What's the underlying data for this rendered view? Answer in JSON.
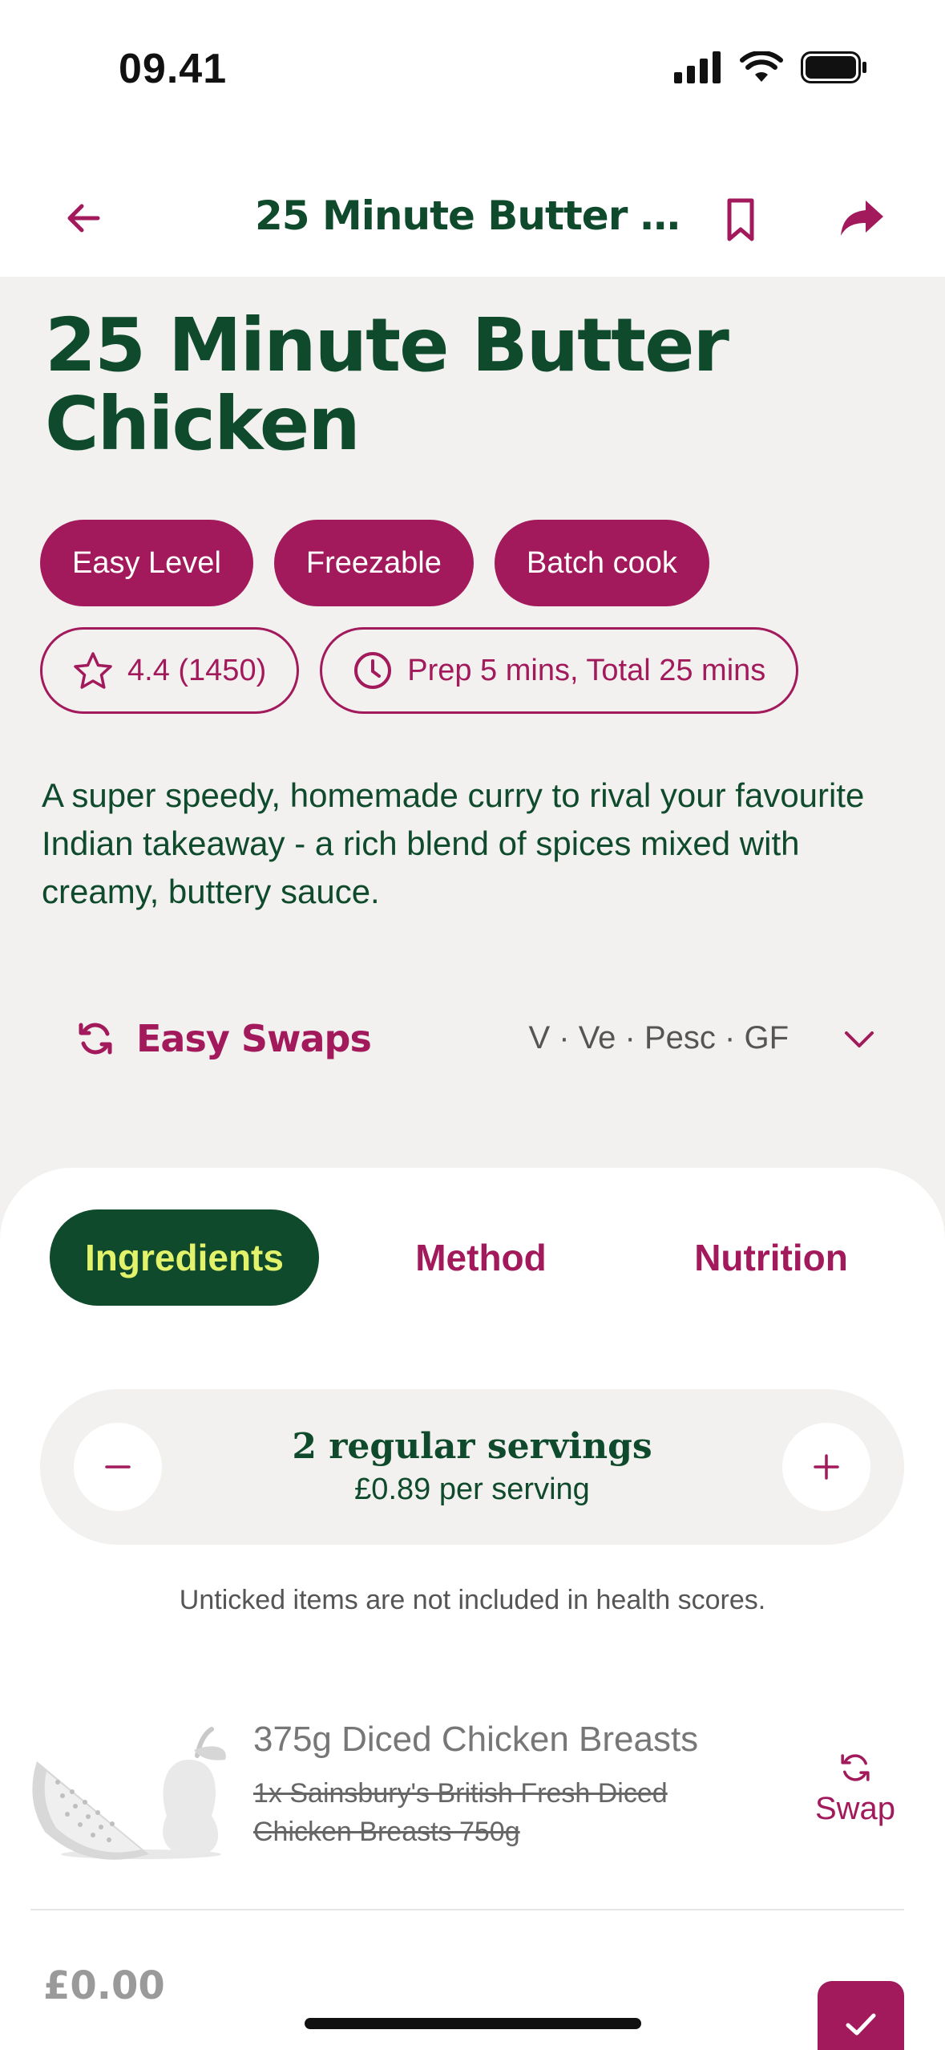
{
  "status_bar": {
    "time": "09.41"
  },
  "nav": {
    "title": "25 Minute Butter Ch..."
  },
  "recipe": {
    "title": "25 Minute Butter Chicken",
    "tags": [
      "Easy Level",
      "Freezable",
      "Batch cook"
    ],
    "rating": "4.4 (1450)",
    "time": "Prep 5 mins, Total 25 mins",
    "description": "A super speedy, homemade curry to rival your favourite Indian takeaway - a rich blend of spices mixed with creamy, buttery sauce."
  },
  "swaps": {
    "label": "Easy Swaps",
    "dietary": "V · Ve · Pesc · GF"
  },
  "tabs": [
    {
      "label": "Ingredients",
      "active": true
    },
    {
      "label": "Method",
      "active": false
    },
    {
      "label": "Nutrition",
      "active": false
    }
  ],
  "servings": {
    "title": "2 regular servings",
    "price": "£0.89 per serving"
  },
  "note": "Unticked items are not included in health scores.",
  "ingredients": [
    {
      "name": "375g Diced Chicken Breasts",
      "product": "1x Sainsbury's British Fresh Diced Chicken Breasts 750g",
      "swap_label": "Swap",
      "image_icon": "placeholder-fruit-icon"
    }
  ],
  "footer": {
    "total": "£0.00"
  },
  "colors": {
    "brand": "#a21a5b",
    "primary": "#0e4a2b",
    "accent": "#e2f26b",
    "background": "#f2f1ef"
  }
}
